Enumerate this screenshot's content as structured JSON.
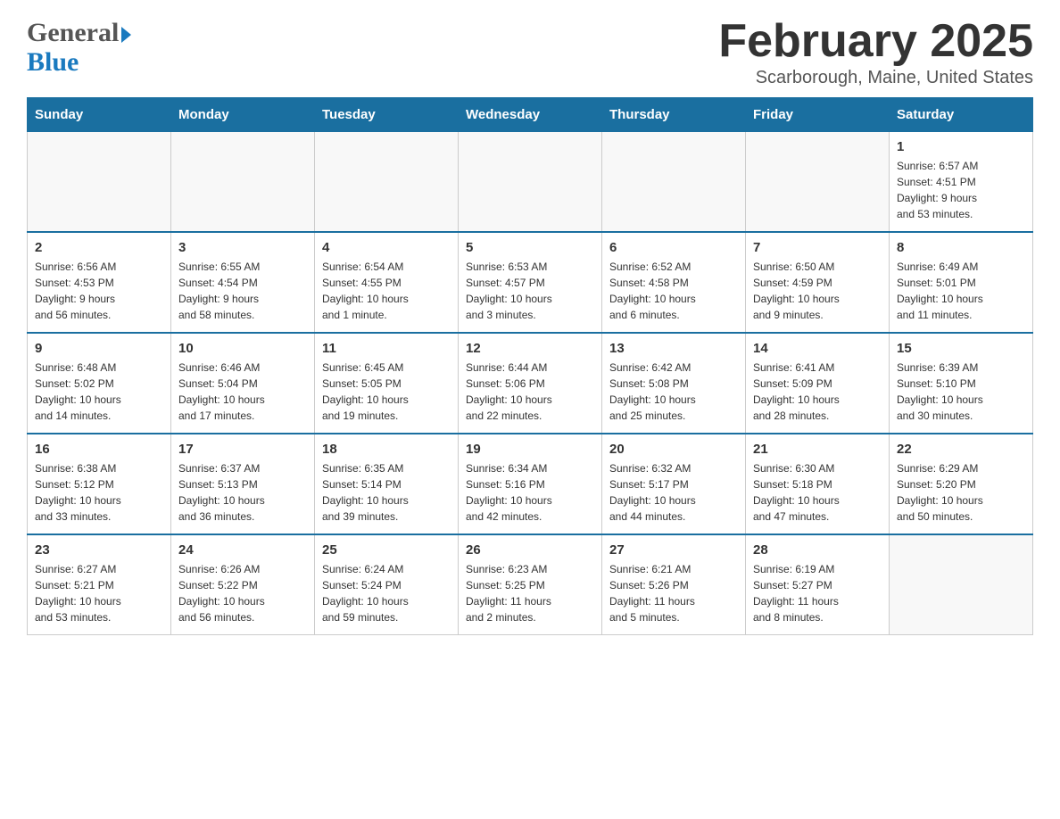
{
  "header": {
    "logo_line1": "General",
    "logo_line2": "Blue",
    "month_title": "February 2025",
    "location": "Scarborough, Maine, United States"
  },
  "weekdays": [
    "Sunday",
    "Monday",
    "Tuesday",
    "Wednesday",
    "Thursday",
    "Friday",
    "Saturday"
  ],
  "rows": [
    {
      "days": [
        {
          "num": "",
          "info": ""
        },
        {
          "num": "",
          "info": ""
        },
        {
          "num": "",
          "info": ""
        },
        {
          "num": "",
          "info": ""
        },
        {
          "num": "",
          "info": ""
        },
        {
          "num": "",
          "info": ""
        },
        {
          "num": "1",
          "info": "Sunrise: 6:57 AM\nSunset: 4:51 PM\nDaylight: 9 hours\nand 53 minutes."
        }
      ]
    },
    {
      "days": [
        {
          "num": "2",
          "info": "Sunrise: 6:56 AM\nSunset: 4:53 PM\nDaylight: 9 hours\nand 56 minutes."
        },
        {
          "num": "3",
          "info": "Sunrise: 6:55 AM\nSunset: 4:54 PM\nDaylight: 9 hours\nand 58 minutes."
        },
        {
          "num": "4",
          "info": "Sunrise: 6:54 AM\nSunset: 4:55 PM\nDaylight: 10 hours\nand 1 minute."
        },
        {
          "num": "5",
          "info": "Sunrise: 6:53 AM\nSunset: 4:57 PM\nDaylight: 10 hours\nand 3 minutes."
        },
        {
          "num": "6",
          "info": "Sunrise: 6:52 AM\nSunset: 4:58 PM\nDaylight: 10 hours\nand 6 minutes."
        },
        {
          "num": "7",
          "info": "Sunrise: 6:50 AM\nSunset: 4:59 PM\nDaylight: 10 hours\nand 9 minutes."
        },
        {
          "num": "8",
          "info": "Sunrise: 6:49 AM\nSunset: 5:01 PM\nDaylight: 10 hours\nand 11 minutes."
        }
      ]
    },
    {
      "days": [
        {
          "num": "9",
          "info": "Sunrise: 6:48 AM\nSunset: 5:02 PM\nDaylight: 10 hours\nand 14 minutes."
        },
        {
          "num": "10",
          "info": "Sunrise: 6:46 AM\nSunset: 5:04 PM\nDaylight: 10 hours\nand 17 minutes."
        },
        {
          "num": "11",
          "info": "Sunrise: 6:45 AM\nSunset: 5:05 PM\nDaylight: 10 hours\nand 19 minutes."
        },
        {
          "num": "12",
          "info": "Sunrise: 6:44 AM\nSunset: 5:06 PM\nDaylight: 10 hours\nand 22 minutes."
        },
        {
          "num": "13",
          "info": "Sunrise: 6:42 AM\nSunset: 5:08 PM\nDaylight: 10 hours\nand 25 minutes."
        },
        {
          "num": "14",
          "info": "Sunrise: 6:41 AM\nSunset: 5:09 PM\nDaylight: 10 hours\nand 28 minutes."
        },
        {
          "num": "15",
          "info": "Sunrise: 6:39 AM\nSunset: 5:10 PM\nDaylight: 10 hours\nand 30 minutes."
        }
      ]
    },
    {
      "days": [
        {
          "num": "16",
          "info": "Sunrise: 6:38 AM\nSunset: 5:12 PM\nDaylight: 10 hours\nand 33 minutes."
        },
        {
          "num": "17",
          "info": "Sunrise: 6:37 AM\nSunset: 5:13 PM\nDaylight: 10 hours\nand 36 minutes."
        },
        {
          "num": "18",
          "info": "Sunrise: 6:35 AM\nSunset: 5:14 PM\nDaylight: 10 hours\nand 39 minutes."
        },
        {
          "num": "19",
          "info": "Sunrise: 6:34 AM\nSunset: 5:16 PM\nDaylight: 10 hours\nand 42 minutes."
        },
        {
          "num": "20",
          "info": "Sunrise: 6:32 AM\nSunset: 5:17 PM\nDaylight: 10 hours\nand 44 minutes."
        },
        {
          "num": "21",
          "info": "Sunrise: 6:30 AM\nSunset: 5:18 PM\nDaylight: 10 hours\nand 47 minutes."
        },
        {
          "num": "22",
          "info": "Sunrise: 6:29 AM\nSunset: 5:20 PM\nDaylight: 10 hours\nand 50 minutes."
        }
      ]
    },
    {
      "days": [
        {
          "num": "23",
          "info": "Sunrise: 6:27 AM\nSunset: 5:21 PM\nDaylight: 10 hours\nand 53 minutes."
        },
        {
          "num": "24",
          "info": "Sunrise: 6:26 AM\nSunset: 5:22 PM\nDaylight: 10 hours\nand 56 minutes."
        },
        {
          "num": "25",
          "info": "Sunrise: 6:24 AM\nSunset: 5:24 PM\nDaylight: 10 hours\nand 59 minutes."
        },
        {
          "num": "26",
          "info": "Sunrise: 6:23 AM\nSunset: 5:25 PM\nDaylight: 11 hours\nand 2 minutes."
        },
        {
          "num": "27",
          "info": "Sunrise: 6:21 AM\nSunset: 5:26 PM\nDaylight: 11 hours\nand 5 minutes."
        },
        {
          "num": "28",
          "info": "Sunrise: 6:19 AM\nSunset: 5:27 PM\nDaylight: 11 hours\nand 8 minutes."
        },
        {
          "num": "",
          "info": ""
        }
      ]
    }
  ]
}
